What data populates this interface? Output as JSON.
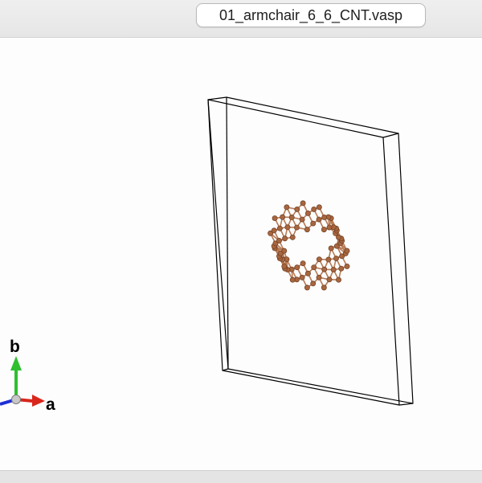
{
  "window": {
    "tab_title": "01_armchair_6_6_CNT.vasp"
  },
  "axes": {
    "a_label": "a",
    "b_label": "b",
    "a_color": "#d9261c",
    "b_color": "#2fbf2f",
    "c_color": "#1f2fd6"
  },
  "structure": {
    "atom_color": "#a8663f",
    "bond_color": "#b77a55",
    "cell_line_color": "#000000"
  }
}
